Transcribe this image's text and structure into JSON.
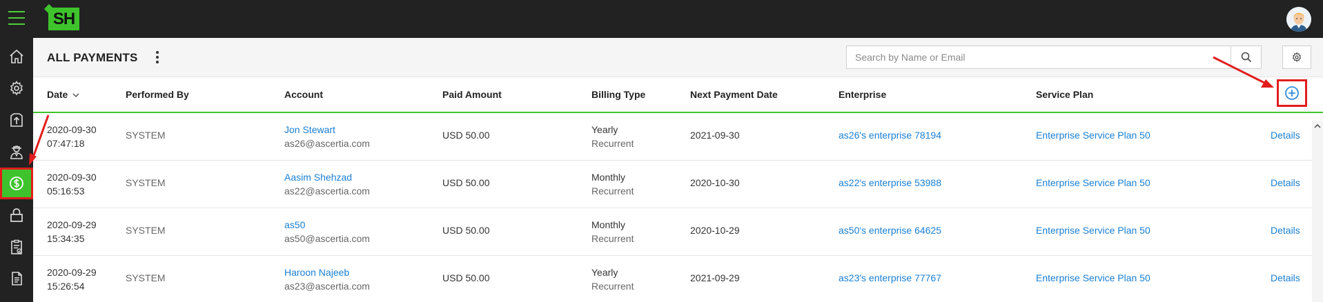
{
  "app": {
    "logo_text": "SH",
    "colors": {
      "accent": "#3ec32c",
      "link": "#1a7fd4",
      "topbar": "#222222",
      "highlight": "#e21c1c"
    }
  },
  "sidebar": {
    "items": [
      {
        "icon": "home-icon"
      },
      {
        "icon": "gear-icon"
      },
      {
        "icon": "upload-box-icon"
      },
      {
        "icon": "user-icon"
      },
      {
        "icon": "dollar-icon",
        "active": true
      },
      {
        "icon": "lock-icon"
      },
      {
        "icon": "clipboard-check-icon"
      },
      {
        "icon": "document-icon"
      }
    ]
  },
  "header": {
    "title": "ALL PAYMENTS",
    "search_placeholder": "Search by Name or Email"
  },
  "table": {
    "columns": [
      "Date",
      "Performed By",
      "Account",
      "Paid Amount",
      "Billing Type",
      "Next Payment Date",
      "Enterprise",
      "Service Plan"
    ],
    "rows": [
      {
        "date": "2020-09-30",
        "time": "07:47:18",
        "performed_by": "SYSTEM",
        "account_name": "Jon Stewart",
        "account_email": "as26@ascertia.com",
        "paid_amount": "USD 50.00",
        "billing_type": "Yearly",
        "billing_mode": "Recurrent",
        "next_payment": "2021-09-30",
        "enterprise": "as26's enterprise 78194",
        "service_plan": "Enterprise Service Plan 50",
        "action": "Details"
      },
      {
        "date": "2020-09-30",
        "time": "05:16:53",
        "performed_by": "SYSTEM",
        "account_name": "Aasim Shehzad",
        "account_email": "as22@ascertia.com",
        "paid_amount": "USD 50.00",
        "billing_type": "Monthly",
        "billing_mode": "Recurrent",
        "next_payment": "2020-10-30",
        "enterprise": "as22's enterprise 53988",
        "service_plan": "Enterprise Service Plan 50",
        "action": "Details"
      },
      {
        "date": "2020-09-29",
        "time": "15:34:35",
        "performed_by": "SYSTEM",
        "account_name": "as50",
        "account_email": "as50@ascertia.com",
        "paid_amount": "USD 50.00",
        "billing_type": "Monthly",
        "billing_mode": "Recurrent",
        "next_payment": "2020-10-29",
        "enterprise": "as50's enterprise 64625",
        "service_plan": "Enterprise Service Plan 50",
        "action": "Details"
      },
      {
        "date": "2020-09-29",
        "time": "15:26:54",
        "performed_by": "SYSTEM",
        "account_name": "Haroon Najeeb",
        "account_email": "as23@ascertia.com",
        "paid_amount": "USD 50.00",
        "billing_type": "Yearly",
        "billing_mode": "Recurrent",
        "next_payment": "2021-09-29",
        "enterprise": "as23's enterprise 77767",
        "service_plan": "Enterprise Service Plan 50",
        "action": "Details"
      }
    ]
  }
}
